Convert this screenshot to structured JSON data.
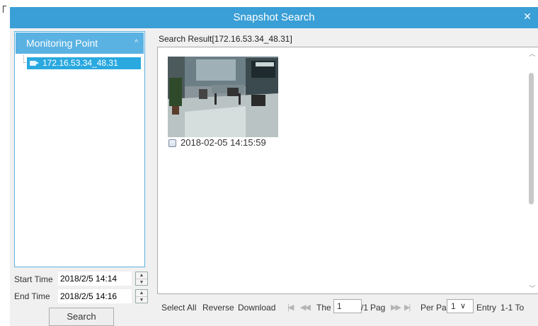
{
  "window": {
    "title": "Snapshot Search",
    "close_glyph": "✕"
  },
  "sidebar": {
    "header": "Monitoring Point",
    "collapse_glyph": "^",
    "items": [
      {
        "label": "172.16.53.34_48.31",
        "icon": "camera-icon",
        "selected": true
      }
    ]
  },
  "time": {
    "start_label": "Start Time",
    "start_value": "2018/2/5 14:14",
    "end_label": "End Time",
    "end_value": "2018/2/5 14:16"
  },
  "search_label": "Search",
  "results": {
    "label": "Search Result[172.16.53.34_48.31]",
    "items": [
      {
        "timestamp": "2018-02-05 14:15:59",
        "checked": false
      }
    ]
  },
  "footer": {
    "select_all": "Select All",
    "reverse": "Reverse",
    "download": "Download",
    "the": "The",
    "page_value": "1",
    "page_total": "/1",
    "page_suffix": "Pag",
    "per_page_label": "Per Pa",
    "per_page_value": "1",
    "entry_label": "Entry",
    "range": "1-1 To"
  },
  "colors": {
    "titlebar": "#3a9fd6",
    "sidebar_header": "#5ab2e3",
    "selected_item": "#2aa9e0"
  }
}
